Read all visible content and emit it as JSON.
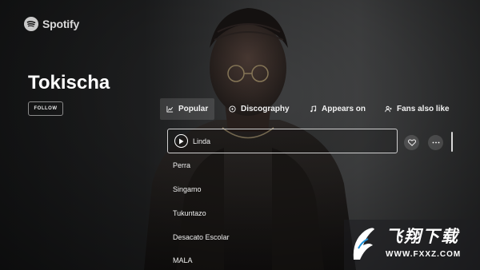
{
  "app": {
    "logo_text": "Spotify"
  },
  "artist": {
    "name": "Tokischa",
    "follow_label": "FOLLOW"
  },
  "tabs": [
    {
      "label": "Popular",
      "icon": "trending-icon",
      "active": true
    },
    {
      "label": "Discography",
      "icon": "disc-icon",
      "active": false
    },
    {
      "label": "Appears on",
      "icon": "music-note-icon",
      "active": false
    },
    {
      "label": "Fans also like",
      "icon": "users-icon",
      "active": false
    }
  ],
  "tracks": [
    {
      "title": "Linda",
      "selected": true
    },
    {
      "title": "Perra",
      "selected": false
    },
    {
      "title": "Singamo",
      "selected": false
    },
    {
      "title": "Tukuntazo",
      "selected": false
    },
    {
      "title": "Desacato Escolar",
      "selected": false
    },
    {
      "title": "MALA",
      "selected": false
    }
  ],
  "track_actions": {
    "like_icon": "heart-icon",
    "more_icon": "more-icon"
  },
  "watermark": {
    "title": "飞翔下载",
    "url": "WWW.FXXZ.COM"
  },
  "colors": {
    "accent_white": "#ffffff",
    "watermark_blue": "#1e90d6"
  }
}
